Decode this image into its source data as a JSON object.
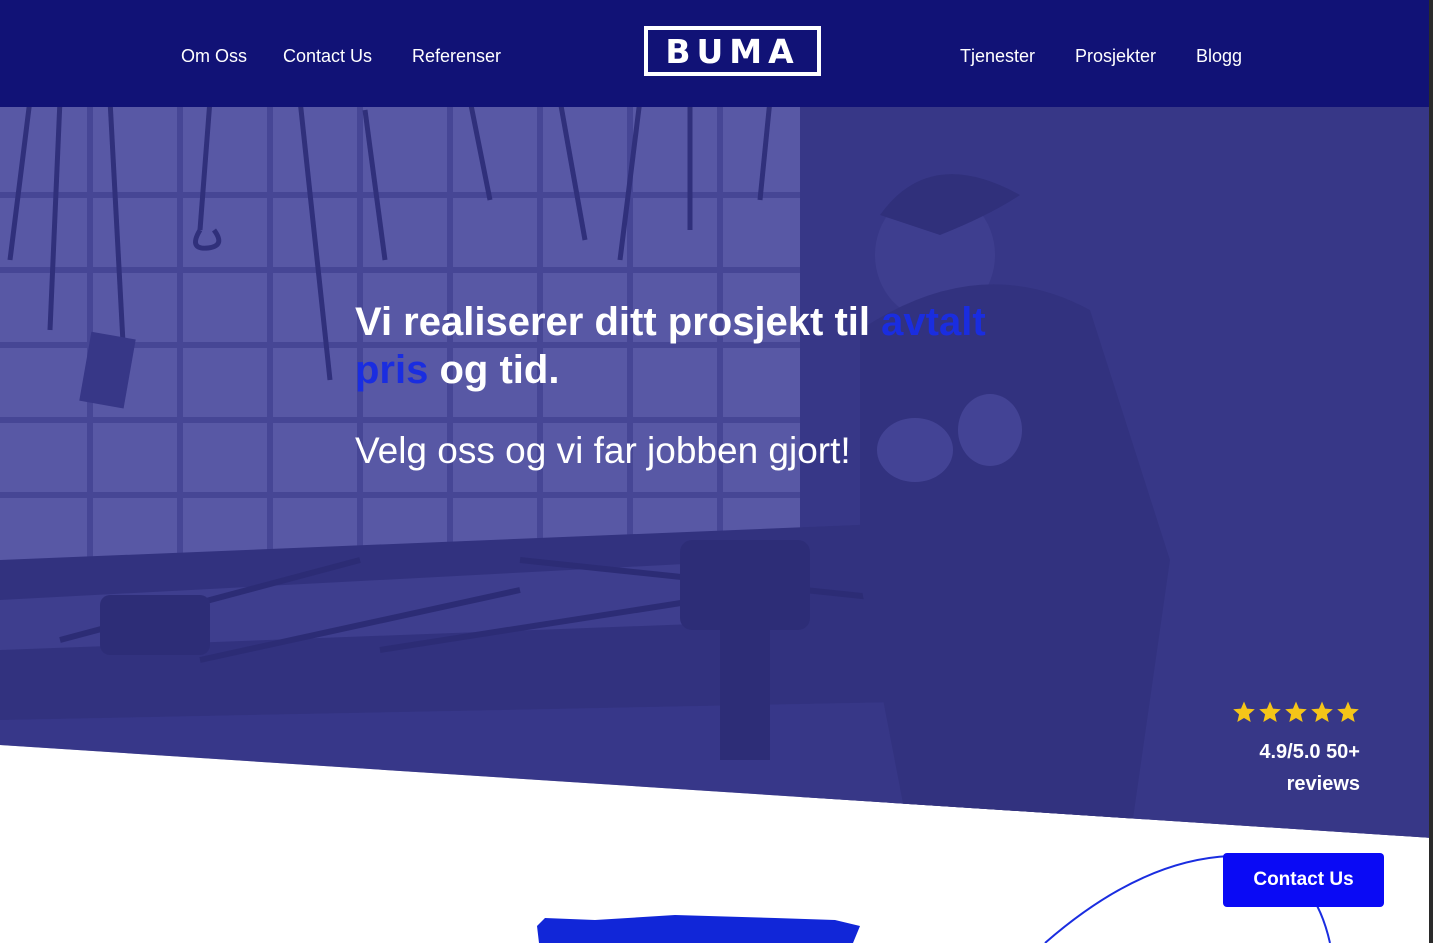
{
  "nav": {
    "left": [
      {
        "label": "Om Oss"
      },
      {
        "label": "Contact Us"
      },
      {
        "label": "Referenser"
      }
    ],
    "logo": "BUMA",
    "right": [
      {
        "label": "Tjenester"
      },
      {
        "label": "Prosjekter"
      },
      {
        "label": "Blogg"
      }
    ]
  },
  "hero": {
    "headline_part1": "Vi realiserer ditt prosjekt til ",
    "headline_accent": "avtalt pris",
    "headline_part2": " og tid.",
    "subline": "Velg oss og vi far jobben gjort!",
    "background_image": "workshop-craftsman-photo"
  },
  "rating": {
    "stars": 5,
    "score": "4.9/5.0 50+",
    "reviews_label": "reviews"
  },
  "cta": {
    "contact_label": "Contact Us"
  },
  "colors": {
    "nav_bg": "#111276",
    "accent": "#1a2de0",
    "button": "#0a0af5",
    "overlay": "#3a3a86",
    "star": "#f5c518"
  }
}
